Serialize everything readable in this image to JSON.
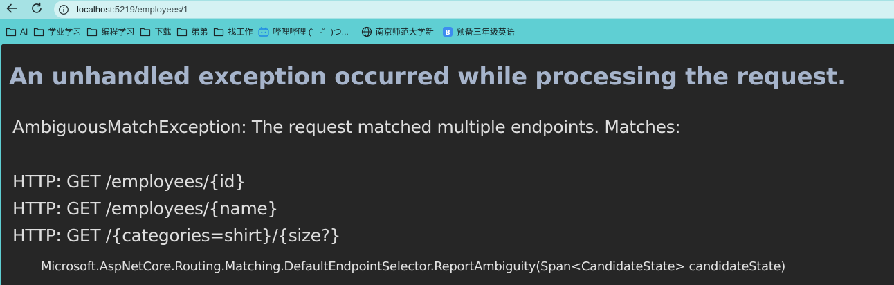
{
  "browser": {
    "address": {
      "host": "localhost",
      "path": ":5219/employees/1"
    },
    "bookmarks": [
      {
        "label": "AI",
        "icon": "folder-icon"
      },
      {
        "label": "学业学习",
        "icon": "folder-icon"
      },
      {
        "label": "编程学习",
        "icon": "folder-icon"
      },
      {
        "label": "下载",
        "icon": "folder-icon"
      },
      {
        "label": "弟弟",
        "icon": "folder-icon"
      },
      {
        "label": "找工作",
        "icon": "folder-icon"
      },
      {
        "label": "哔哩哔哩 (゜-゜)つ...",
        "icon": "bilibili-icon"
      },
      {
        "label": "南京师范大学新",
        "icon": "globe-icon"
      },
      {
        "label": "预备三年级英语",
        "icon": "b-icon"
      }
    ],
    "colors": {
      "tab_bar": "#a6e2e4",
      "bookmark_bar": "#5fcfd3",
      "page_bg": "#262626",
      "title": "#a6b4cb"
    }
  },
  "error_page": {
    "title": "An unhandled exception occurred while processing the request.",
    "message": "AmbiguousMatchException: The request matched multiple endpoints. Matches:",
    "matches": [
      "HTTP: GET /employees/{id}",
      "HTTP: GET /employees/{name}",
      "HTTP: GET /{categories=shirt}/{size?}"
    ],
    "stack_frame": "Microsoft.AspNetCore.Routing.Matching.DefaultEndpointSelector.ReportAmbiguity(Span<CandidateState> candidateState)"
  }
}
